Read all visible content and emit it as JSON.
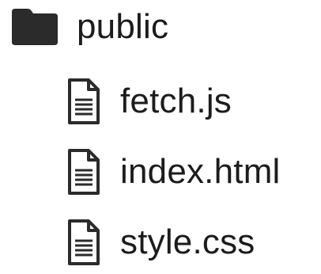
{
  "tree": {
    "folder": {
      "name": "public",
      "icon": "folder-icon"
    },
    "files": [
      {
        "name": "fetch.js",
        "icon": "file-text-icon"
      },
      {
        "name": "index.html",
        "icon": "file-text-icon"
      },
      {
        "name": "style.css",
        "icon": "file-text-icon"
      }
    ]
  },
  "colors": {
    "icon": "#2b2b2b",
    "text": "#1c1c1c",
    "background": "#ffffff"
  }
}
